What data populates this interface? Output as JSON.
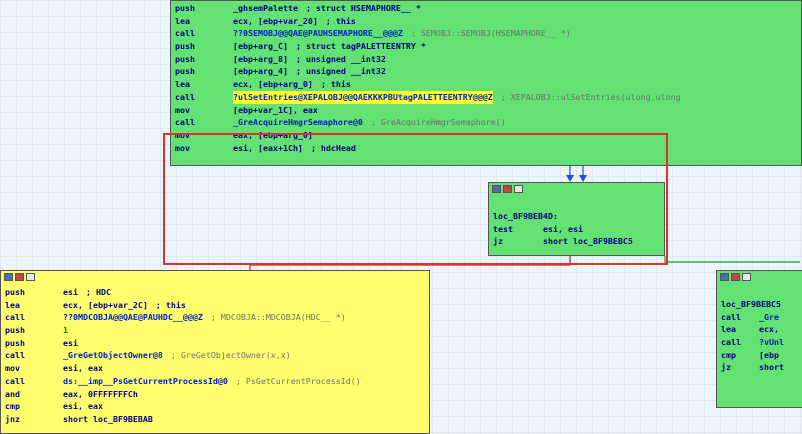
{
  "top_block": {
    "lines": [
      {
        "op": "push",
        "arg": "_ghsemPalette",
        "comment": "; struct HSEMAPHORE__ *",
        "comment_style": "bold"
      },
      {
        "op": "lea",
        "arg": "ecx, [ebp+var_20]",
        "comment": "; this",
        "comment_style": "bold"
      },
      {
        "op": "call",
        "arg": "??0SEMOBJ@@QAE@PAUHSEMAPHORE__@@@Z",
        "comment": "; SEMOBJ::SEMOBJ(HSEMAPHORE__ *)",
        "comment_style": "grey"
      },
      {
        "op": "push",
        "arg": "[ebp+arg_C]",
        "comment": "; struct tagPALETTEENTRY *",
        "comment_style": "bold"
      },
      {
        "op": "push",
        "arg": "[ebp+arg_8]",
        "comment": "; unsigned __int32",
        "comment_style": "bold"
      },
      {
        "op": "push",
        "arg": "[ebp+arg_4]",
        "comment": "; unsigned __int32",
        "comment_style": "bold"
      },
      {
        "op": "lea",
        "arg": "ecx, [ebp+arg_0]",
        "comment": "; this",
        "comment_style": "bold"
      },
      {
        "op": "call",
        "arg": "?ulSetEntries@XEPALOBJ@@QAEKKKPBUtagPALETTEENTRY@@@Z",
        "comment": "; XEPALOBJ::ulSetEntries(ulong,ulong",
        "comment_style": "grey",
        "highlight": true
      },
      {
        "op": "mov",
        "arg": "[ebp+var_1C], eax",
        "comment": "",
        "comment_style": "bold"
      },
      {
        "op": "call",
        "arg": "_GreAcquireHmgrSemaphore@0",
        "comment": "; GreAcquireHmgrSemaphore()",
        "comment_style": "grey"
      },
      {
        "op": "mov",
        "arg": "eax, [ebp+arg_0]",
        "comment": "",
        "comment_style": "bold"
      },
      {
        "op": "mov",
        "arg": "esi, [eax+1Ch]",
        "comment": "; hdcHead",
        "comment_style": "bold"
      }
    ]
  },
  "mid_block": {
    "label": "loc_BF9BEB4D:",
    "lines": [
      {
        "op": "test",
        "arg": "esi, esi"
      },
      {
        "op": "jz",
        "arg": "short loc_BF9BEBC5"
      }
    ]
  },
  "left_block": {
    "lines": [
      {
        "op": "push",
        "arg": "esi",
        "comment": "; HDC",
        "comment_style": "bold"
      },
      {
        "op": "lea",
        "arg": "ecx, [ebp+var_2C]",
        "comment": "; this",
        "comment_style": "bold"
      },
      {
        "op": "call",
        "arg": "??0MDCOBJA@@QAE@PAUHDC__@@@Z",
        "comment": "; MDCOBJA::MDCOBJA(HDC__ *)",
        "comment_style": "grey"
      },
      {
        "op": "push",
        "arg": "1",
        "comment": "",
        "comment_style": "bold",
        "num": true
      },
      {
        "op": "push",
        "arg": "esi",
        "comment": "",
        "comment_style": "bold"
      },
      {
        "op": "call",
        "arg": "_GreGetObjectOwner@8",
        "comment": "; GreGetObjectOwner(x,x)",
        "comment_style": "grey"
      },
      {
        "op": "mov",
        "arg": "esi, eax",
        "comment": "",
        "comment_style": "bold"
      },
      {
        "op": "call",
        "arg": "ds:__imp__PsGetCurrentProcessId@0",
        "comment": "; PsGetCurrentProcessId()",
        "comment_style": "grey"
      },
      {
        "op": "and",
        "arg": "eax, 0FFFFFFFCh",
        "comment": "",
        "comment_style": "bold"
      },
      {
        "op": "cmp",
        "arg": "esi, eax",
        "comment": "",
        "comment_style": "bold"
      },
      {
        "op": "jnz",
        "arg": "short loc_BF9BEBAB",
        "comment": "",
        "comment_style": "bold"
      }
    ]
  },
  "right_block": {
    "label": "loc_BF9BEBC5",
    "lines": [
      {
        "op": "call",
        "arg": "_Gre"
      },
      {
        "op": "lea",
        "arg": "ecx,"
      },
      {
        "op": "call",
        "arg": "?vUnl"
      },
      {
        "op": "cmp",
        "arg": "[ebp"
      },
      {
        "op": "jz",
        "arg": "short"
      }
    ]
  },
  "colors": {
    "green": "#63e173",
    "yellow": "#ffff6e",
    "red_box": "#e0302a",
    "edge_blue": "#1d4fd8",
    "edge_red": "#d02020",
    "edge_green": "#209040"
  }
}
